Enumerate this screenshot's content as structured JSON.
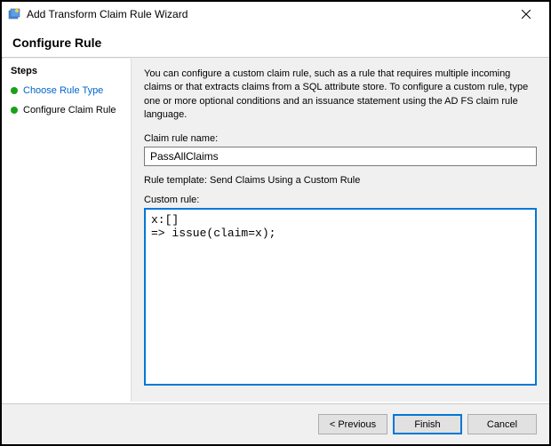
{
  "window": {
    "title": "Add Transform Claim Rule Wizard"
  },
  "header": {
    "title": "Configure Rule"
  },
  "sidebar": {
    "section_label": "Steps",
    "items": [
      {
        "label": "Choose Rule Type",
        "active": true
      },
      {
        "label": "Configure Claim Rule",
        "active": false
      }
    ]
  },
  "main": {
    "instructions": "You can configure a custom claim rule, such as a rule that requires multiple incoming claims or that extracts claims from a SQL attribute store. To configure a custom rule, type one or more optional conditions and an issuance statement using the AD FS claim rule language.",
    "claim_rule_name_label": "Claim rule name:",
    "claim_rule_name_value": "PassAllClaims",
    "rule_template_label": "Rule template: Send Claims Using a Custom Rule",
    "custom_rule_label": "Custom rule:",
    "custom_rule_value": "x:[]\n=> issue(claim=x);"
  },
  "footer": {
    "previous": "< Previous",
    "finish": "Finish",
    "cancel": "Cancel"
  }
}
